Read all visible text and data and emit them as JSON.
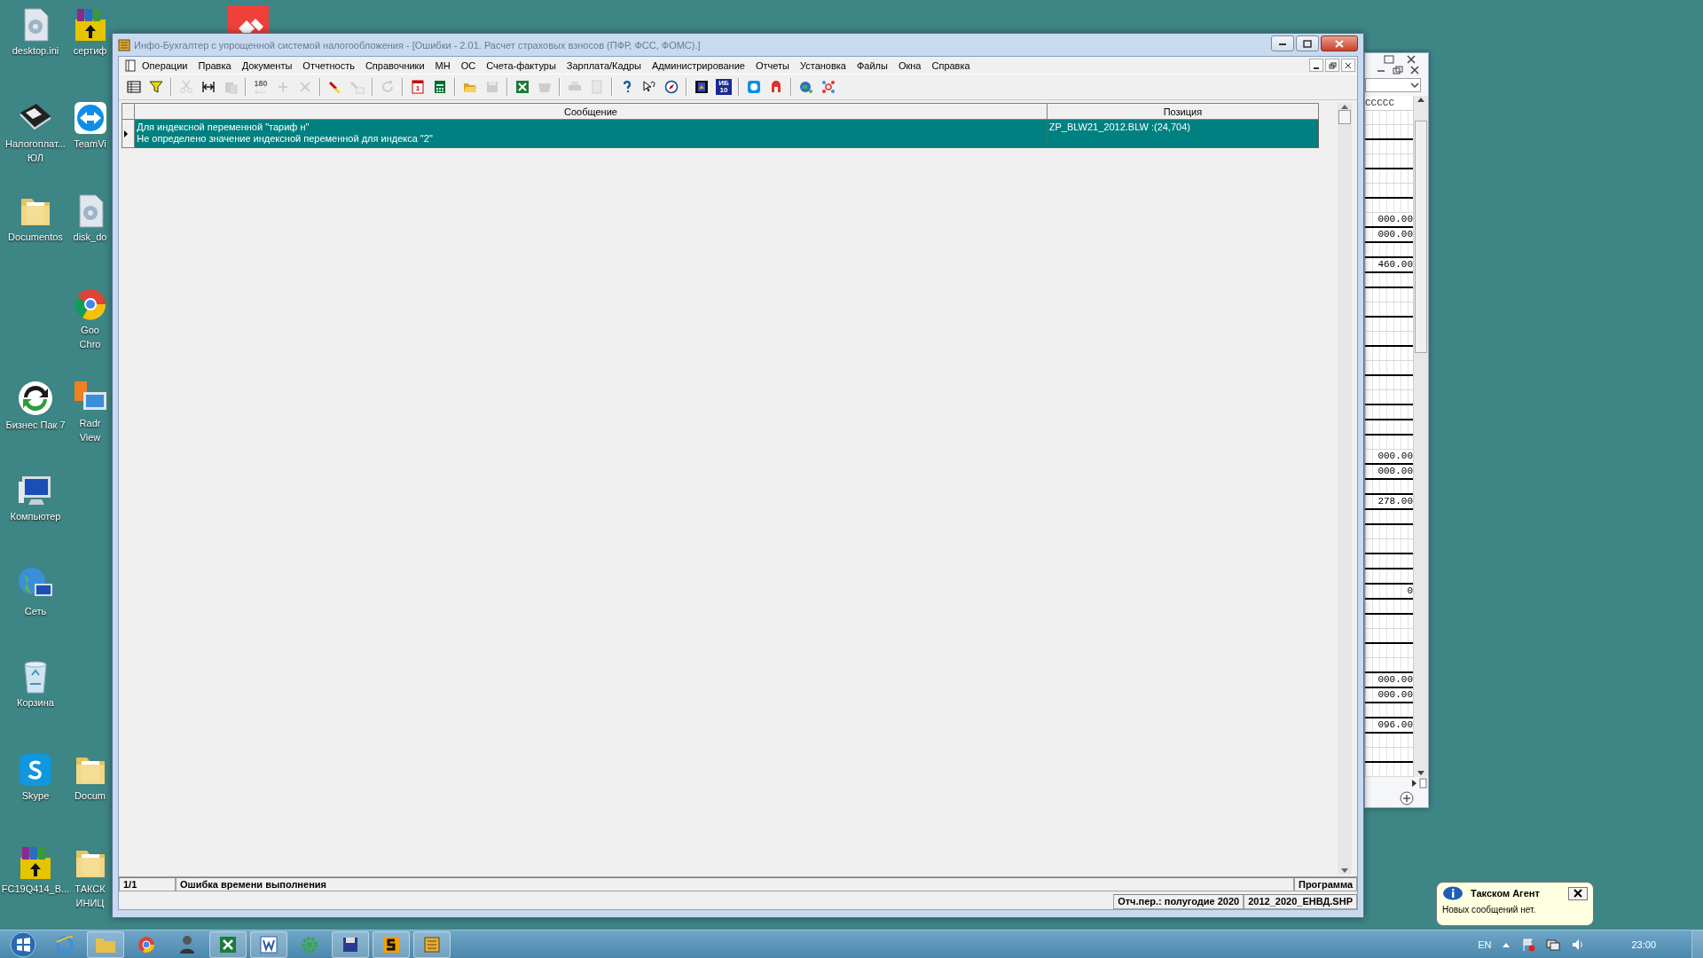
{
  "desktop": {
    "column_1": [
      {
        "kind": "settings",
        "lines": [
          "desktop.ini"
        ]
      },
      {
        "kind": "floppy",
        "lines": [
          "Налогоплат...",
          "ЮЛ"
        ]
      },
      {
        "kind": "folder",
        "lines": [
          "Documentos"
        ]
      },
      {
        "kind": "cycle",
        "lines": [
          "Бизнес Пак 7"
        ]
      },
      {
        "kind": "computer",
        "lines": [
          "Компьютер"
        ]
      },
      {
        "kind": "globe",
        "lines": [
          "Сеть"
        ]
      },
      {
        "kind": "recycle",
        "lines": [
          "Корзина"
        ]
      },
      {
        "kind": "skype",
        "lines": [
          "Skype"
        ]
      },
      {
        "kind": "archive",
        "lines": [
          "FC19Q414_B..."
        ]
      }
    ],
    "column_2": [
      {
        "kind": "archive",
        "lines": [
          "сертиф"
        ]
      },
      {
        "kind": "remote",
        "lines": [
          "TeamVi"
        ]
      },
      {
        "kind": "settings",
        "lines": [
          "disk_do"
        ]
      },
      {
        "kind": "browser",
        "lines": [
          "Goo",
          "Chro"
        ]
      },
      {
        "kind": "viewer",
        "lines": [
          "Radr",
          "View"
        ]
      },
      {
        "kind": "folder",
        "lines": [
          "Docum"
        ]
      },
      {
        "kind": "folder",
        "lines": [
          "ТАКСК",
          "ИНИЦ"
        ]
      }
    ]
  },
  "back_window": {
    "header": "CCCCC",
    "values": [
      "000.00",
      "000.00",
      "460.00",
      "000.00",
      "000.00",
      "278.00",
      "0",
      "000.00",
      "000.00",
      "096.00"
    ]
  },
  "window": {
    "title": "Инфо-Бухгалтер с упрощенной системой налогообложения - [Ошибки - 2.01.   Расчет страховых взносов (ПФР, ФСС, ФОМС).]",
    "menu": [
      "Операции",
      "Правка",
      "Документы",
      "Отчетность",
      "Справочники",
      "МН",
      "ОС",
      "Счета-фактуры",
      "Зарплата/Кадры",
      "Администрирование",
      "Отчеты",
      "Установка",
      "Файлы",
      "Окна",
      "Справка"
    ],
    "toolbar": [
      {
        "disabled": false
      },
      {
        "disabled": false
      },
      {
        "disabled": true
      },
      {
        "disabled": false
      },
      {
        "disabled": true
      },
      {
        "disabled": true,
        "lines": [
          "180"
        ]
      },
      {
        "disabled": true
      },
      {
        "disabled": true
      },
      {
        "disabled": false
      },
      {
        "disabled": true
      },
      {
        "disabled": true
      },
      {
        "disabled": false,
        "lines": [
          "1"
        ]
      },
      {
        "disabled": false
      },
      {
        "disabled": false
      },
      {
        "disabled": true
      },
      {
        "disabled": false
      },
      {
        "disabled": true
      },
      {
        "disabled": true
      },
      {
        "disabled": true
      },
      {
        "disabled": false
      },
      {
        "disabled": false
      },
      {
        "disabled": false
      },
      {
        "disabled": false
      },
      {
        "disabled": false,
        "lines": [
          "ИБ",
          "10"
        ]
      },
      {
        "disabled": false
      },
      {
        "disabled": false
      },
      {
        "disabled": false
      },
      {
        "disabled": false
      }
    ],
    "table": {
      "columns": [
        "Сообщение",
        "Позиция"
      ],
      "rows": [
        {
          "selected": true,
          "message": [
            "Для индексной переменной \"тариф  н\"",
            "Не определено значение индексной переменной для индекса \"2\""
          ],
          "position": "ZP_BLW21_2012.BLW :(24,704)"
        }
      ]
    },
    "status_bar": {
      "counter": "1/1",
      "message": "Ошибка времени выполнения",
      "source": "Программа"
    },
    "status_bar_2": {
      "period": "Отч.пер.: полугодие 2020",
      "file": "2012_2020_ЕНВД.SHP"
    }
  },
  "notification": {
    "title": "Такском Агент",
    "text": "Новых сообщений нет."
  },
  "taskbar": {
    "language": "EN",
    "clock": "23:00"
  }
}
